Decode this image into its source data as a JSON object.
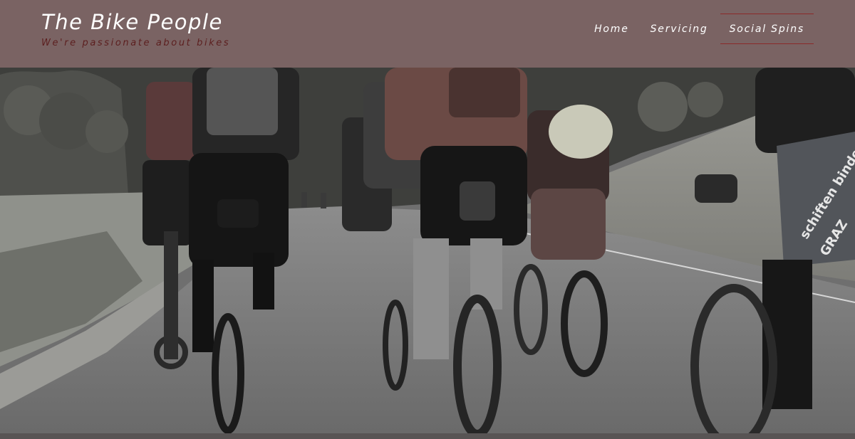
{
  "site": {
    "title": "The Bike People",
    "tagline": "We're passionate about bikes"
  },
  "nav": {
    "items": [
      {
        "label": "Home",
        "name": "nav-item-home",
        "active": false
      },
      {
        "label": "Servicing",
        "name": "nav-item-servicing",
        "active": false
      },
      {
        "label": "Social Spins",
        "name": "nav-item-social-spins",
        "active": true
      }
    ]
  },
  "hero": {
    "jersey_text_line1": "schiften binder",
    "jersey_text_line2": "GRAZ"
  },
  "colors": {
    "header_background": "#7a6363",
    "tagline": "#5c1f1f",
    "active_nav_border": "#8b2a2a"
  }
}
